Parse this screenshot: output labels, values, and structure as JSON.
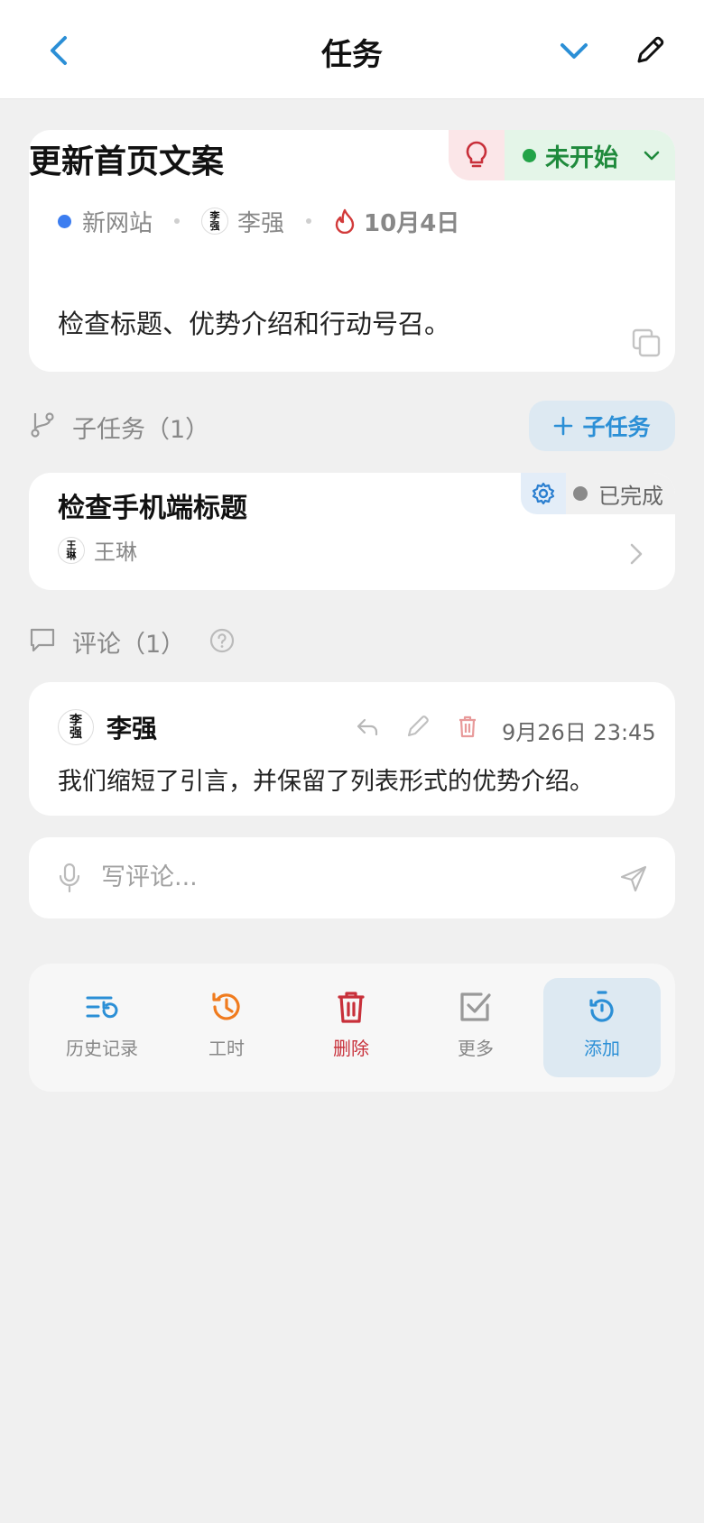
{
  "header": {
    "title": "任务"
  },
  "task": {
    "title": "更新首页文案",
    "status": "未开始",
    "project": "新网站",
    "assignee": "李强",
    "assignee_avatar": "李\n强",
    "due_date": "10月4日",
    "description": "检查标题、优势介绍和行动号召。"
  },
  "subtasks": {
    "label": "子任务（1）",
    "add_label": "子任务",
    "items": [
      {
        "title": "检查手机端标题",
        "status": "已完成",
        "assignee": "王琳",
        "assignee_avatar": "王\n琳"
      }
    ]
  },
  "comments": {
    "label": "评论（1）",
    "items": [
      {
        "author": "李强",
        "avatar": "李\n强",
        "time": "9月26日 23:45",
        "text": "我们缩短了引言，并保留了列表形式的优势介绍。"
      }
    ],
    "input_placeholder": "写评论..."
  },
  "toolbar": {
    "history": "历史记录",
    "worktime": "工时",
    "delete": "删除",
    "more": "更多",
    "add": "添加"
  },
  "colors": {
    "accent": "#2b8fd6",
    "status_not_started": "#22a347",
    "status_done": "#8a8a8a",
    "danger": "#c8303a",
    "worktime": "#f07b1e"
  }
}
